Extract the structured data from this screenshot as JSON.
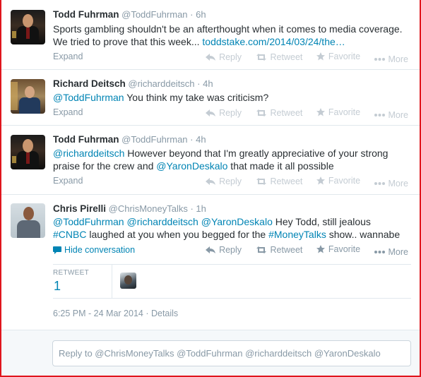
{
  "tweets": [
    {
      "fullname": "Todd Fuhrman",
      "username": "@ToddFuhrman",
      "time": "· 6h",
      "line1": "Sports gambling shouldn't be an afterthought when it comes to media coverage.",
      "line2_text": "We tried to prove that this week... ",
      "line2_link": "toddstake.com/2014/03/24/the…",
      "expand": "Expand"
    },
    {
      "fullname": "Richard Deitsch",
      "username": "@richarddeitsch",
      "time": "· 4h",
      "mention": "@ToddFuhrman",
      "line1_rest": " You think my take was criticism?",
      "expand": "Expand"
    },
    {
      "fullname": "Todd Fuhrman",
      "username": "@ToddFuhrman",
      "time": "· 4h",
      "mention": "@richarddeitsch",
      "line1_rest": " However beyond that I'm greatly appreciative of your strong",
      "line2_pre": "praise for the crew and ",
      "line2_mention": "@YaronDeskalo",
      "line2_rest": " that made it all possible",
      "expand": "Expand"
    },
    {
      "fullname": "Chris Pirelli",
      "username": "@ChrisMoneyTalks",
      "time": "· 1h",
      "m1": "@ToddFuhrman",
      "m2": "@richarddeitsch",
      "m3": "@YaronDeskalo",
      "line1_rest": " Hey Todd, still jealous",
      "h1": "#CNBC",
      "line2_mid": " laughed at you when you begged for the ",
      "h2": "#MoneyTalks",
      "line2_rest": " show.. wannabe",
      "hide": "Hide conversation"
    }
  ],
  "actions": {
    "reply": "Reply",
    "retweet": "Retweet",
    "favorite": "Favorite",
    "more": "More"
  },
  "stats": {
    "label": "RETWEET",
    "count": "1"
  },
  "datestamp": {
    "when": "6:25 PM - 24 Mar 2014",
    "sep": " · ",
    "details": "Details"
  },
  "reply_box": {
    "placeholder": "Reply to @ChrisMoneyTalks @ToddFuhrman @richarddeitsch @YaronDeskalo"
  },
  "colors": {
    "link": "#0084b4",
    "muted": "#8899a6",
    "frame": "#e0151d"
  }
}
